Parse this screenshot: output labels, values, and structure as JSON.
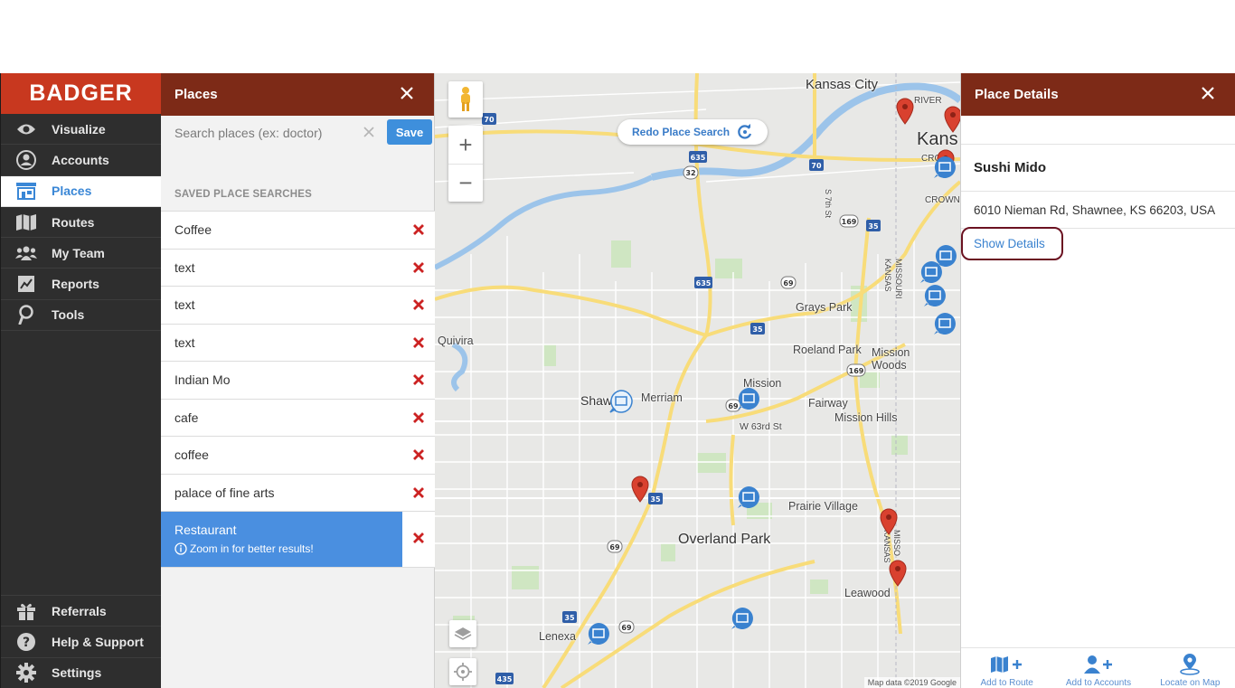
{
  "brand": {
    "logo_text": "BADGER",
    "accent": "#c8381f",
    "header_color": "#7d2a17",
    "primary_blue": "#3e8fdc"
  },
  "nav": {
    "items": [
      {
        "label": "Visualize",
        "icon": "eye-icon"
      },
      {
        "label": "Accounts",
        "icon": "user-circle-icon"
      },
      {
        "label": "Places",
        "icon": "storefront-icon",
        "active": true
      },
      {
        "label": "Routes",
        "icon": "map-icon"
      },
      {
        "label": "My Team",
        "icon": "team-icon"
      },
      {
        "label": "Reports",
        "icon": "chart-icon"
      },
      {
        "label": "Tools",
        "icon": "wrench-icon"
      }
    ],
    "bottom_items": [
      {
        "label": "Referrals",
        "icon": "gift-icon"
      },
      {
        "label": "Help & Support",
        "icon": "help-icon"
      },
      {
        "label": "Settings",
        "icon": "gear-icon"
      }
    ]
  },
  "places_panel": {
    "title": "Places",
    "search_placeholder": "Search places (ex: doctor)",
    "search_value": "",
    "save_label": "Save",
    "saved_heading": "SAVED PLACE SEARCHES",
    "saved_searches": [
      "Coffee",
      "text",
      "text",
      "text",
      "Indian Mo",
      "cafe",
      "coffee",
      "palace of fine arts"
    ],
    "selected_search": {
      "label": "Restaurant",
      "hint": "Zoom in for better results!"
    }
  },
  "map": {
    "redo_label": "Redo Place Search",
    "attribution": "Map data ©2019 Google",
    "labels": [
      "Kansas City",
      "Kans",
      "RIVER",
      "CRO",
      "CROWN",
      "Quivira",
      "Shaw",
      "Merriam",
      "Mission",
      "Roeland Park",
      "Grays Park",
      "Mission Woods",
      "Fairway",
      "Mission Hills",
      "W 63rd St",
      "Prairie Village",
      "Overland Park",
      "Leawood",
      "Lenexa",
      "S 7th St",
      "MISSOURI",
      "KANSAS",
      "MISSO",
      "KANSAS"
    ],
    "shields": [
      "70",
      "635",
      "32",
      "70",
      "169",
      "35",
      "635",
      "69",
      "35",
      "169",
      "69",
      "35",
      "69",
      "35",
      "69",
      "435"
    ]
  },
  "details_panel": {
    "title": "Place Details",
    "place_name": "Sushi Mido",
    "address": "6010 Nieman Rd, Shawnee, KS 66203, USA",
    "show_details_label": "Show Details",
    "actions": [
      {
        "label": "Add to Route",
        "icon": "map-plus-icon"
      },
      {
        "label": "Add to Accounts",
        "icon": "user-plus-icon"
      },
      {
        "label": "Locate on Map",
        "icon": "location-pin-icon"
      }
    ]
  }
}
